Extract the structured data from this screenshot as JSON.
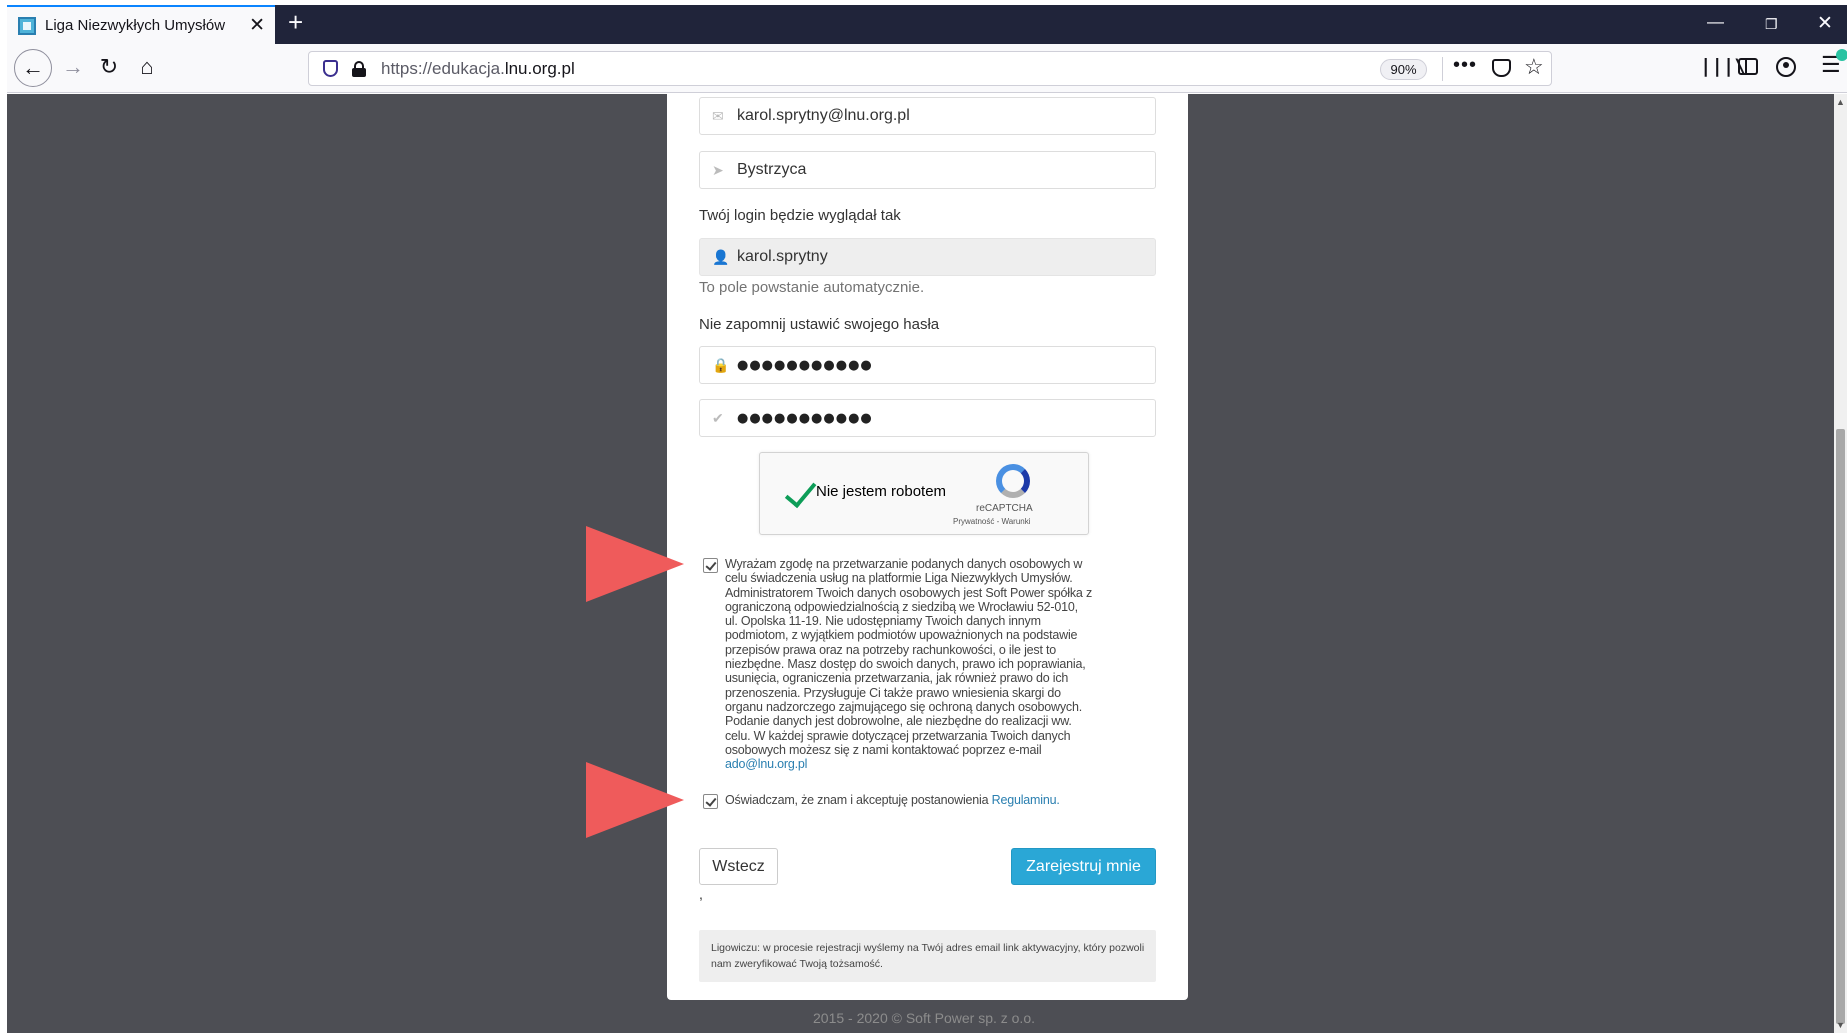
{
  "browser": {
    "tab_title": "Liga Niezwykłych Umysłów",
    "tab_close": "✕",
    "new_tab": "+",
    "url_prefix": "https://edukacja.",
    "url_host": "lnu.org.pl",
    "zoom": "90%",
    "more": "•••",
    "star": "☆",
    "library": "|||\\",
    "menu": "☰",
    "back": "←",
    "forward": "→",
    "reload": "↻",
    "home": "⌂",
    "win_min": "—",
    "win_restore": "❐",
    "win_close": "✕"
  },
  "form": {
    "email_value": "karol.sprytny@lnu.org.pl",
    "city_value": "Bystrzyca",
    "login_label": "Twój login będzie wyglądał tak",
    "login_value": "karol.sprytny",
    "login_help": "To pole powstanie automatycznie.",
    "password_label": "Nie zapomnij ustawić swojego hasła",
    "password_mask": "●●●●●●●●●●●",
    "password_confirm_mask": "●●●●●●●●●●●",
    "icons": {
      "email": "✉",
      "city": "➤",
      "login": "👤",
      "password": "🔒",
      "confirm": "✔"
    }
  },
  "recaptcha": {
    "label": "Nie jestem robotem",
    "brand": "reCAPTCHA",
    "links": "Prywatność - Warunki"
  },
  "consent": {
    "text": "Wyrażam zgodę na przetwarzanie podanych danych osobowych w celu świadczenia usług na platformie Liga Niezwykłych Umysłów. Administratorem Twoich danych osobowych jest Soft Power spółka z ograniczoną odpowiedzialnością z siedzibą we Wrocławiu 52-010, ul. Opolska 11-19. Nie udostępniamy Twoich danych innym podmiotom, z wyjątkiem podmiotów upoważnionych na podstawie przepisów prawa oraz na potrzeby rachunkowości, o ile jest to niezbędne. Masz dostęp do swoich danych, prawo ich poprawiania, usunięcia, ograniczenia przetwarzania, jak również prawo do ich przenoszenia. Przysługuje Ci także prawo wniesienia skargi do organu nadzorczego zajmującego się ochroną danych osobowych. Podanie danych jest dobrowolne, ale niezbędne do realizacji ww. celu. W każdej sprawie dotyczącej przetwarzania Twoich danych osobowych możesz się z nami kontaktować poprzez e-mail",
    "email": "ado@lnu.org.pl",
    "checked": true
  },
  "terms": {
    "text": "Oświadczam, że znam i akceptuję postanowienia",
    "link": "Regulaminu",
    "period": ".",
    "checked": true
  },
  "buttons": {
    "back": "Wstecz",
    "register": "Zarejestruj mnie"
  },
  "stray_mark": ",",
  "info": "Ligowiczu: w procesie rejestracji wyślemy na Twój adres email link aktywacyjny, który pozwoli nam zweryfikować Twoją tożsamość.",
  "footer": "2015 - 2020 © Soft Power sp. z o.o.",
  "colors": {
    "page_background": "#4d4e54",
    "primary_button": "#2aa7d6",
    "annotation_arrow": "#ef5b5b",
    "recaptcha_check": "#0d9d58"
  }
}
